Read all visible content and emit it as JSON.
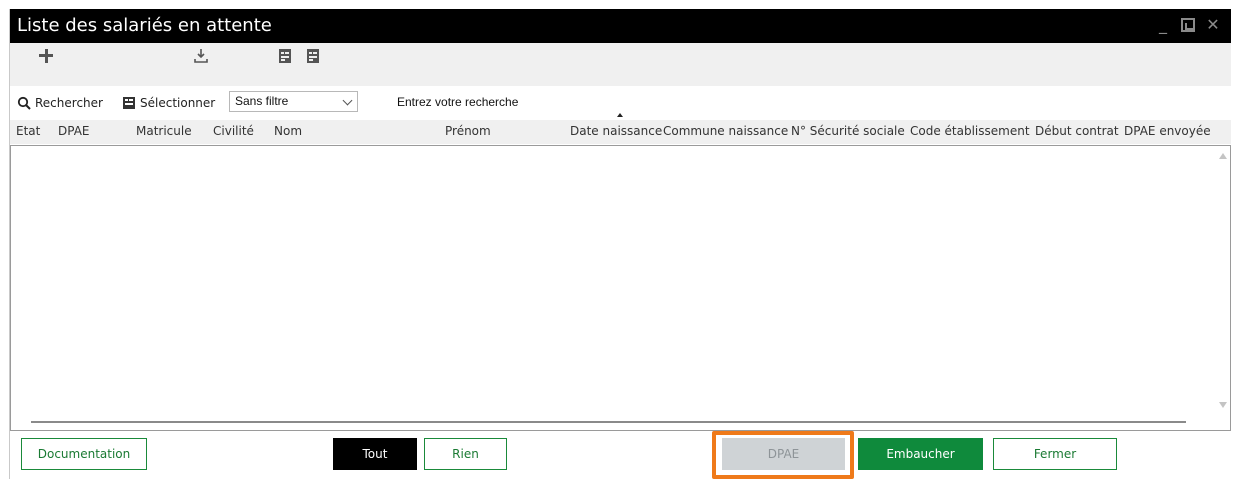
{
  "window": {
    "title": "Liste des salariés en attente",
    "controls": [
      "minimize-icon",
      "restore-icon",
      "close-icon"
    ]
  },
  "toolbar": {
    "icons": [
      "plus-icon",
      "export-icon",
      "doc-icon",
      "doc-icon"
    ]
  },
  "search": {
    "search_label": "Rechercher",
    "select_label": "Sélectionner",
    "filter_value": "Sans filtre",
    "hint": "Entrez votre recherche"
  },
  "table": {
    "columns": [
      "Etat",
      "DPAE",
      "Matricule",
      "Civilité",
      "Nom",
      "Prénom",
      "Date naissance",
      "Commune naissance",
      "N° Sécurité sociale",
      "Code établissement",
      "Début contrat",
      "DPAE envoyée"
    ],
    "rows": []
  },
  "footer": {
    "documentation": "Documentation",
    "tout": "Tout",
    "rien": "Rien",
    "dpae": "DPAE",
    "embaucher": "Embaucher",
    "fermer": "Fermer"
  },
  "colors": {
    "titlebar": "#000000",
    "accent_green": "#0f8a3c",
    "highlight": "#ef7a1a",
    "disabled": "#cfd3d6"
  }
}
